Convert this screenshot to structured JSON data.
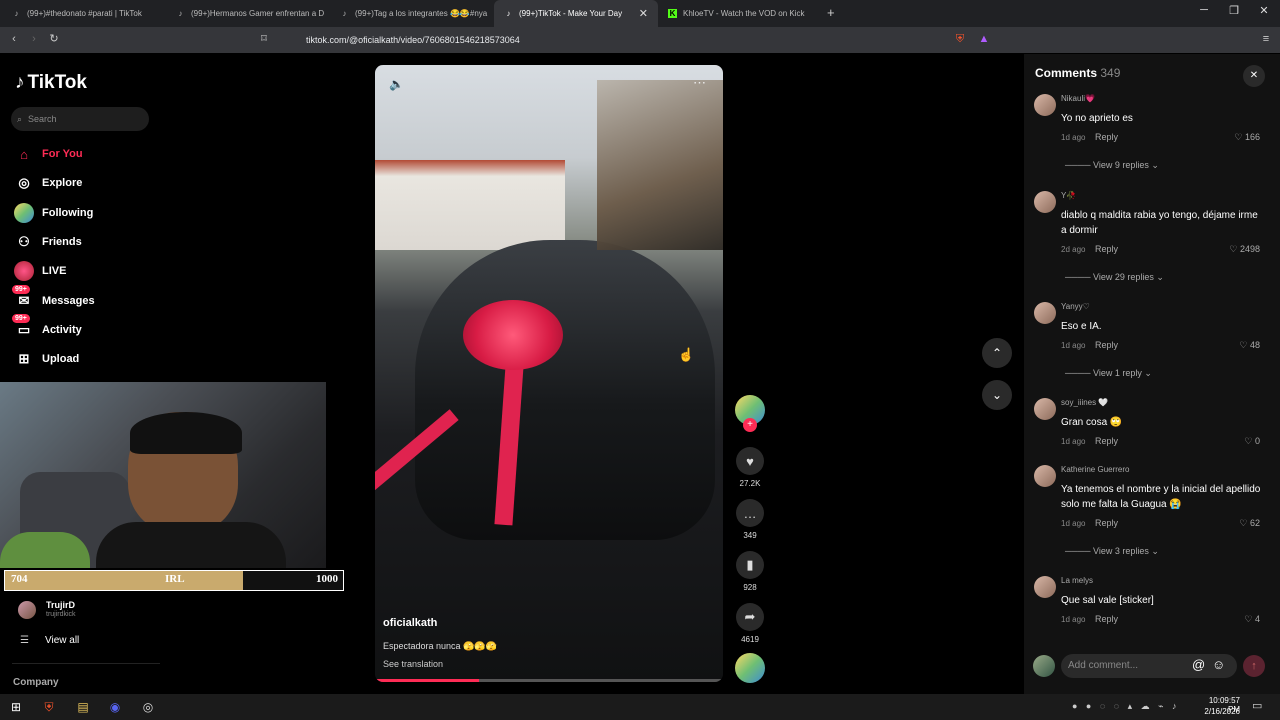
{
  "browser": {
    "tabs": [
      {
        "label": "(99+)#thedonato #parati | TikTok"
      },
      {
        "label": "(99+)Hermanos Gamer enfrentan a D"
      },
      {
        "label": "(99+)Tag a los integrantes 😂😂#nya"
      },
      {
        "label": "(99+)TikTok - Make Your Day"
      },
      {
        "label": "KhloeTV - Watch the VOD on Kick"
      }
    ],
    "new_tab": "+",
    "url": "tiktok.com/@oficialkath/video/7606801546218573064"
  },
  "sidebar": {
    "logo": "TikTok",
    "search_placeholder": "Search",
    "items": [
      {
        "label": "For You",
        "icon": "home-icon"
      },
      {
        "label": "Explore",
        "icon": "compass-icon"
      },
      {
        "label": "Following",
        "icon": "following-icon"
      },
      {
        "label": "Friends",
        "icon": "friends-icon"
      },
      {
        "label": "LIVE",
        "icon": "live-icon"
      },
      {
        "label": "Messages",
        "icon": "messages-icon",
        "badge": "99+"
      },
      {
        "label": "Activity",
        "icon": "activity-icon",
        "badge": "99+"
      },
      {
        "label": "Upload",
        "icon": "upload-icon"
      }
    ],
    "following_account": {
      "name": "TrujirD",
      "handle": "trujirdkick"
    },
    "view_all": "View all",
    "company": "Company"
  },
  "stream_overlay": {
    "progress_left": "704",
    "progress_label": "IRL",
    "progress_right": "1000",
    "progress_fraction": 0.704
  },
  "video": {
    "author": "oficialkath",
    "caption": "Espectadora nunca 🫣🫣🫣",
    "see_translation": "See translation",
    "likes": "27.2K",
    "comments": "349",
    "saves": "928",
    "shares": "4619",
    "playback_fraction": 0.3
  },
  "comments_panel": {
    "title": "Comments",
    "count": "349",
    "items": [
      {
        "user": "Nikauli💗",
        "text": "Yo no aprieto es",
        "time": "1d ago",
        "reply": "Reply",
        "likes": "166",
        "view_replies": "View 9 replies"
      },
      {
        "user": "Y🥀",
        "text": "diablo q maldita rabia yo tengo, déjame irme a dormir",
        "time": "2d ago",
        "reply": "Reply",
        "likes": "2498",
        "view_replies": "View 29 replies"
      },
      {
        "user": "Yanyy♡",
        "text": "Eso e IA.",
        "time": "1d ago",
        "reply": "Reply",
        "likes": "48",
        "view_replies": "View 1 reply"
      },
      {
        "user": "soy_iiines 🤍",
        "text": "Gran cosa 🙄",
        "time": "1d ago",
        "reply": "Reply",
        "likes": "0",
        "view_replies": ""
      },
      {
        "user": "Katherine Guerrero",
        "text": "Ya tenemos el nombre y la inicial del apellido solo me falta la Guagua 😭",
        "time": "1d ago",
        "reply": "Reply",
        "likes": "62",
        "view_replies": "View 3 replies"
      },
      {
        "user": "La melys",
        "text": "Que sal vale [sticker]",
        "time": "1d ago",
        "reply": "Reply",
        "likes": "4",
        "view_replies": ""
      }
    ],
    "add_placeholder": "Add comment..."
  },
  "taskbar": {
    "time": "10:09:57 PM",
    "date": "2/16/2026"
  },
  "colors": {
    "accent": "#fe2c55",
    "progress": "#c9aa6d"
  }
}
